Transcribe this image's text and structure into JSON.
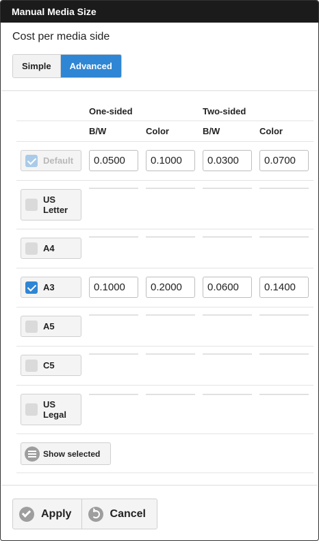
{
  "window": {
    "title": "Manual Media Size"
  },
  "section": {
    "subtitle": "Cost per media side"
  },
  "mode_toggle": {
    "simple_label": "Simple",
    "advanced_label": "Advanced",
    "selected": "Advanced"
  },
  "table": {
    "group_headers": {
      "one_sided": "One-sided",
      "two_sided": "Two-sided"
    },
    "column_headers": {
      "one_bw": "B/W",
      "one_color": "Color",
      "two_bw": "B/W",
      "two_color": "Color"
    },
    "rows": [
      {
        "name": "Default",
        "checked": true,
        "disabled": true,
        "values": [
          "0.0500",
          "0.1000",
          "0.0300",
          "0.0700"
        ]
      },
      {
        "name": "US Letter",
        "checked": false,
        "values": []
      },
      {
        "name": "A4",
        "checked": false,
        "values": []
      },
      {
        "name": "A3",
        "checked": true,
        "values": [
          "0.1000",
          "0.2000",
          "0.0600",
          "0.1400"
        ]
      },
      {
        "name": "A5",
        "checked": false,
        "values": []
      },
      {
        "name": "C5",
        "checked": false,
        "values": []
      },
      {
        "name": "US Legal",
        "checked": false,
        "values": []
      }
    ]
  },
  "show_selected": {
    "label": "Show selected",
    "icon": "list-icon"
  },
  "footer": {
    "apply_label": "Apply",
    "apply_icon": "check-circle-icon",
    "cancel_label": "Cancel",
    "cancel_icon": "undo-icon"
  },
  "colors": {
    "accent": "#2f86d4",
    "titlebar": "#1b1b1b"
  }
}
